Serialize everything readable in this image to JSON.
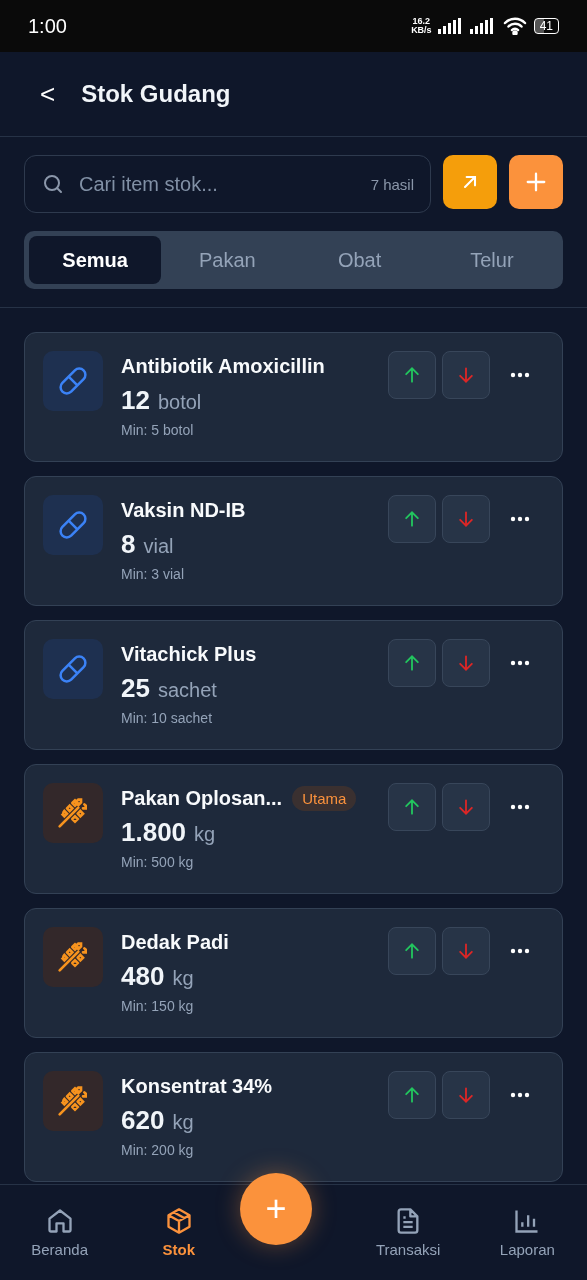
{
  "status_bar": {
    "time": "1:00",
    "net_speed": "16.2",
    "net_unit": "KB/s",
    "battery": "41"
  },
  "header": {
    "back": "<",
    "title": "Stok Gudang"
  },
  "search": {
    "placeholder": "Cari item stok...",
    "count": "7 hasil"
  },
  "tabs": [
    {
      "label": "Semua",
      "selected": true
    },
    {
      "label": "Pakan",
      "selected": false
    },
    {
      "label": "Obat",
      "selected": false
    },
    {
      "label": "Telur",
      "selected": false
    }
  ],
  "items": [
    {
      "kind": "obat",
      "name": "Antibiotik Amoxicillin",
      "qty": "12",
      "unit": "botol",
      "min": "Min: 5 botol"
    },
    {
      "kind": "obat",
      "name": "Vaksin ND-IB",
      "qty": "8",
      "unit": "vial",
      "min": "Min: 3 vial"
    },
    {
      "kind": "obat",
      "name": "Vitachick Plus",
      "qty": "25",
      "unit": "sachet",
      "min": "Min: 10 sachet"
    },
    {
      "kind": "pakan",
      "name": "Pakan Oplosan...",
      "badge": "Utama",
      "qty": "1.800",
      "unit": "kg",
      "min": "Min: 500 kg"
    },
    {
      "kind": "pakan",
      "name": "Dedak Padi",
      "qty": "480",
      "unit": "kg",
      "min": "Min: 150 kg"
    },
    {
      "kind": "pakan",
      "name": "Konsentrat 34%",
      "qty": "620",
      "unit": "kg",
      "min": "Min: 200 kg"
    }
  ],
  "fab": "+",
  "nav": [
    {
      "kind": "home",
      "label": "Beranda",
      "selected": false
    },
    {
      "kind": "box",
      "label": "Stok",
      "selected": true
    },
    {
      "kind": "doc",
      "label": "Transaksi",
      "selected": false
    },
    {
      "kind": "chart",
      "label": "Laporan",
      "selected": false
    }
  ]
}
